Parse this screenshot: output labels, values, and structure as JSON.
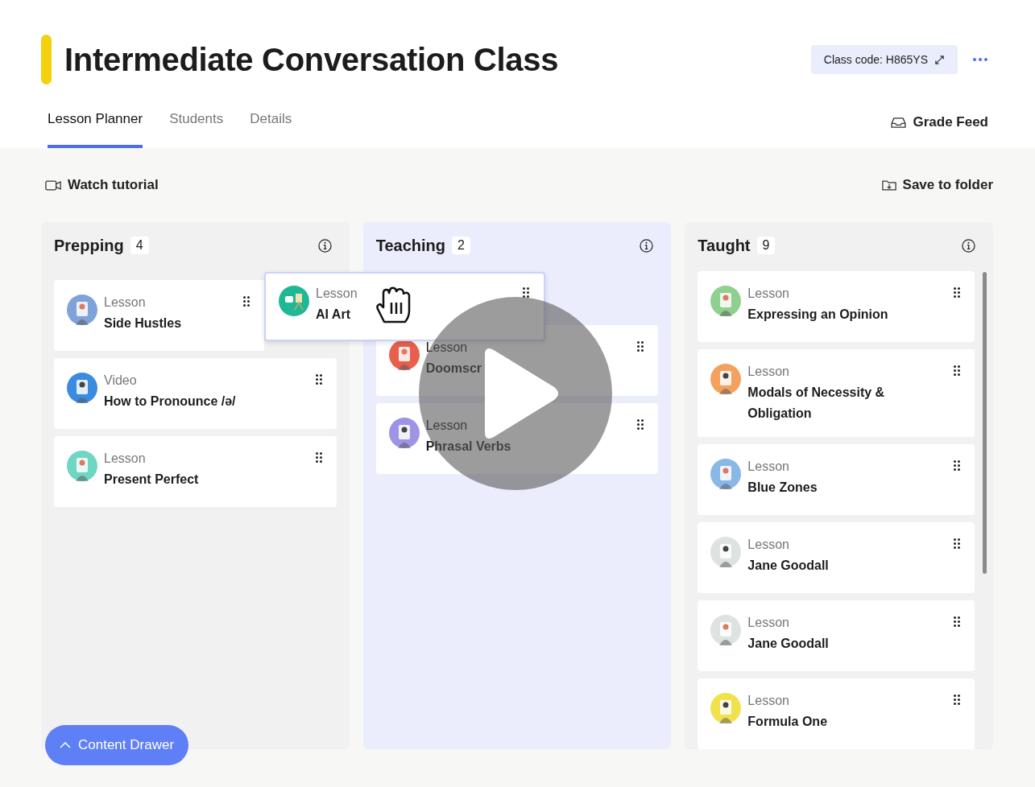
{
  "header": {
    "title": "Intermediate Conversation Class",
    "class_code": "Class code: H865YS"
  },
  "tabs": [
    {
      "label": "Lesson Planner",
      "selected": true
    },
    {
      "label": "Students",
      "selected": false
    },
    {
      "label": "Details",
      "selected": false
    }
  ],
  "grade_feed": "Grade Feed",
  "toolbar": {
    "watch_tutorial": "Watch tutorial",
    "save_to_folder": "Save to folder"
  },
  "columns": [
    {
      "title": "Prepping",
      "count": "4",
      "cards": [
        {
          "type": "Lesson",
          "title": "Side Hustles",
          "color": "#7fa3d9"
        },
        {
          "type": "Video",
          "title": "How to Pronounce /ə/",
          "color": "#3b8be0"
        },
        {
          "type": "Lesson",
          "title": "Present Perfect",
          "color": "#6fd6c3"
        }
      ]
    },
    {
      "title": "Teaching",
      "count": "2",
      "cards": [
        {
          "type": "Lesson",
          "title": "Doomscr",
          "color": "#e8604c"
        },
        {
          "type": "Lesson",
          "title": "Phrasal Verbs",
          "color": "#9d94e6"
        }
      ]
    },
    {
      "title": "Taught",
      "count": "9",
      "cards": [
        {
          "type": "Lesson",
          "title": "Expressing an Opinion",
          "color": "#8fd08f"
        },
        {
          "type": "Lesson",
          "title": "Modals of Necessity & Obligation",
          "color": "#f5a15e"
        },
        {
          "type": "Lesson",
          "title": "Blue Zones",
          "color": "#8ab8e6"
        },
        {
          "type": "Lesson",
          "title": "Jane Goodall",
          "color": "#dde3e0"
        },
        {
          "type": "Lesson",
          "title": "Jane Goodall",
          "color": "#dde3e0"
        },
        {
          "type": "Lesson",
          "title": "Formula One",
          "color": "#f0e24d"
        }
      ]
    }
  ],
  "dragged_card": {
    "type": "Lesson",
    "title": "AI Art",
    "color": "#1fb895"
  },
  "content_drawer": "Content Drawer"
}
